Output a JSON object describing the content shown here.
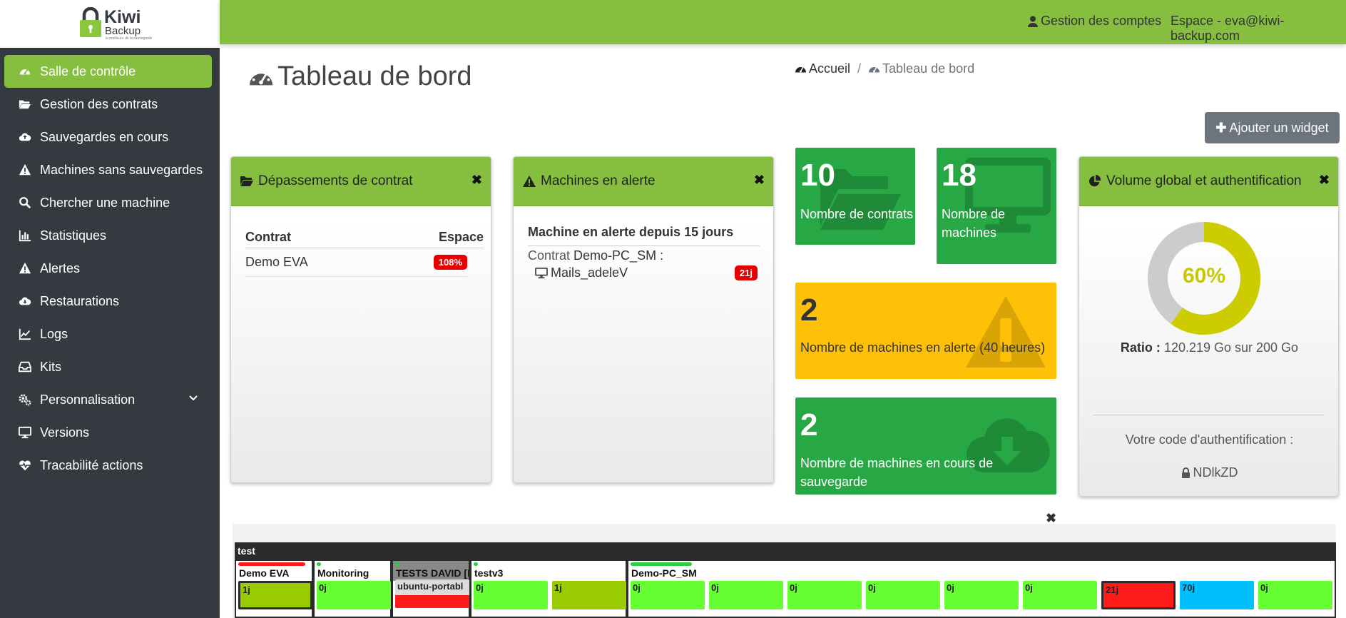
{
  "logo": {
    "word1": "Kiwi",
    "word2": "Backup",
    "tagline": "la meilleure de la sauvegarde"
  },
  "colors": {
    "sidebar": "#343a40",
    "accent": "#86bf3f",
    "success": "#28a745",
    "warning": "#ffc107",
    "danger": "#e80000",
    "info": "#00bfff",
    "secondary": "#6c757d"
  },
  "menu": [
    {
      "label": "Salle de contrôle",
      "icon": "dashboard-icon",
      "active": true
    },
    {
      "label": "Gestion des contrats",
      "icon": "folder-open-icon"
    },
    {
      "label": "Sauvegardes en cours",
      "icon": "cloud-upload-icon"
    },
    {
      "label": "Machines sans sauvegardes",
      "icon": "warning-icon"
    },
    {
      "label": "Chercher une machine",
      "icon": "search-icon"
    },
    {
      "label": "Statistiques",
      "icon": "bar-chart-icon"
    },
    {
      "label": "Alertes",
      "icon": "warning-icon"
    },
    {
      "label": "Restaurations",
      "icon": "cloud-download-icon"
    },
    {
      "label": "Logs",
      "icon": "line-chart-icon"
    },
    {
      "label": "Kits",
      "icon": "inbox-icon"
    },
    {
      "label": "Personnalisation",
      "icon": "cogs-icon",
      "has_submenu": true
    },
    {
      "label": "Versions",
      "icon": "desktop-icon"
    },
    {
      "label": "Tracabilité actions",
      "icon": "heartbeat-icon"
    }
  ],
  "topbar": {
    "accounts": "Gestion des comptes",
    "space": "Espace - eva@kiwi-backup.com"
  },
  "page": {
    "title": "Tableau de bord"
  },
  "breadcrumb": {
    "home": "Accueil",
    "separator": "/",
    "current": "Tableau de bord"
  },
  "add_widget": "Ajouter un widget",
  "widget_overruns": {
    "title": "Dépassements de contrat",
    "col_contract": "Contrat",
    "col_space": "Espace",
    "rows": [
      {
        "contract": "Demo EVA",
        "space": "108%"
      }
    ]
  },
  "widget_alerts": {
    "title": "Machines en alerte",
    "subtitle": "Machine en alerte depuis 15 jours",
    "contract_label": "Contrat",
    "contract_name": "Demo-PC_SM :",
    "machine": "Mails_adeleV",
    "days": "21j"
  },
  "tiles": {
    "contracts": {
      "value": "10",
      "label": "Nombre de contrats"
    },
    "machines": {
      "value": "18",
      "label": "Nombre de machines"
    },
    "alerts": {
      "value": "2",
      "label": "Nombre de machines en alerte (40 heures)"
    },
    "in_progress": {
      "value": "2",
      "label": "Nombre de machines en cours de sauvegarde"
    }
  },
  "widget_volume": {
    "title": "Volume global et authentification",
    "percent": "60%",
    "ratio_value": 0.6,
    "ratio_label": "Ratio :",
    "ratio_text": "120.219 Go sur 200 Go",
    "auth_label": "Votre code d'authentification :",
    "auth_code": "NDlkZD"
  },
  "monitor": {
    "group": "test",
    "contracts": [
      {
        "name": "Demo EVA",
        "bar": "#ff1a1a",
        "machines": [
          {
            "label": "1j",
            "color": "#99cc00",
            "sel": true
          }
        ]
      },
      {
        "name": "Monitoring",
        "bar": "#2ecc40",
        "machines": [
          {
            "label": "0j",
            "color": "#66ff33"
          }
        ]
      },
      {
        "name": "TESTS DAVID [IN",
        "bar": "#2ecc40",
        "header_gray": true,
        "machines": [
          {
            "label": "ubuntu-portabl",
            "color": "#ff1a1a"
          }
        ]
      },
      {
        "name": "testv3",
        "bar": "#2ecc40",
        "machines": [
          {
            "label": "0j",
            "color": "#66ff33"
          },
          {
            "label": "1j",
            "color": "#99cc00"
          }
        ]
      },
      {
        "name": "Demo-PC_SM",
        "bar": "#2ecc40",
        "machines": [
          {
            "label": "0j",
            "color": "#66ff33"
          },
          {
            "label": "0j",
            "color": "#66ff33"
          },
          {
            "label": "0j",
            "color": "#66ff33"
          },
          {
            "label": "0j",
            "color": "#66ff33"
          },
          {
            "label": "0j",
            "color": "#66ff33"
          },
          {
            "label": "0j",
            "color": "#66ff33"
          },
          {
            "label": "21j",
            "color": "#ff1a1a",
            "sel": true
          },
          {
            "label": "70j",
            "color": "#00bfff"
          },
          {
            "label": "0j",
            "color": "#66ff33"
          }
        ]
      }
    ]
  }
}
